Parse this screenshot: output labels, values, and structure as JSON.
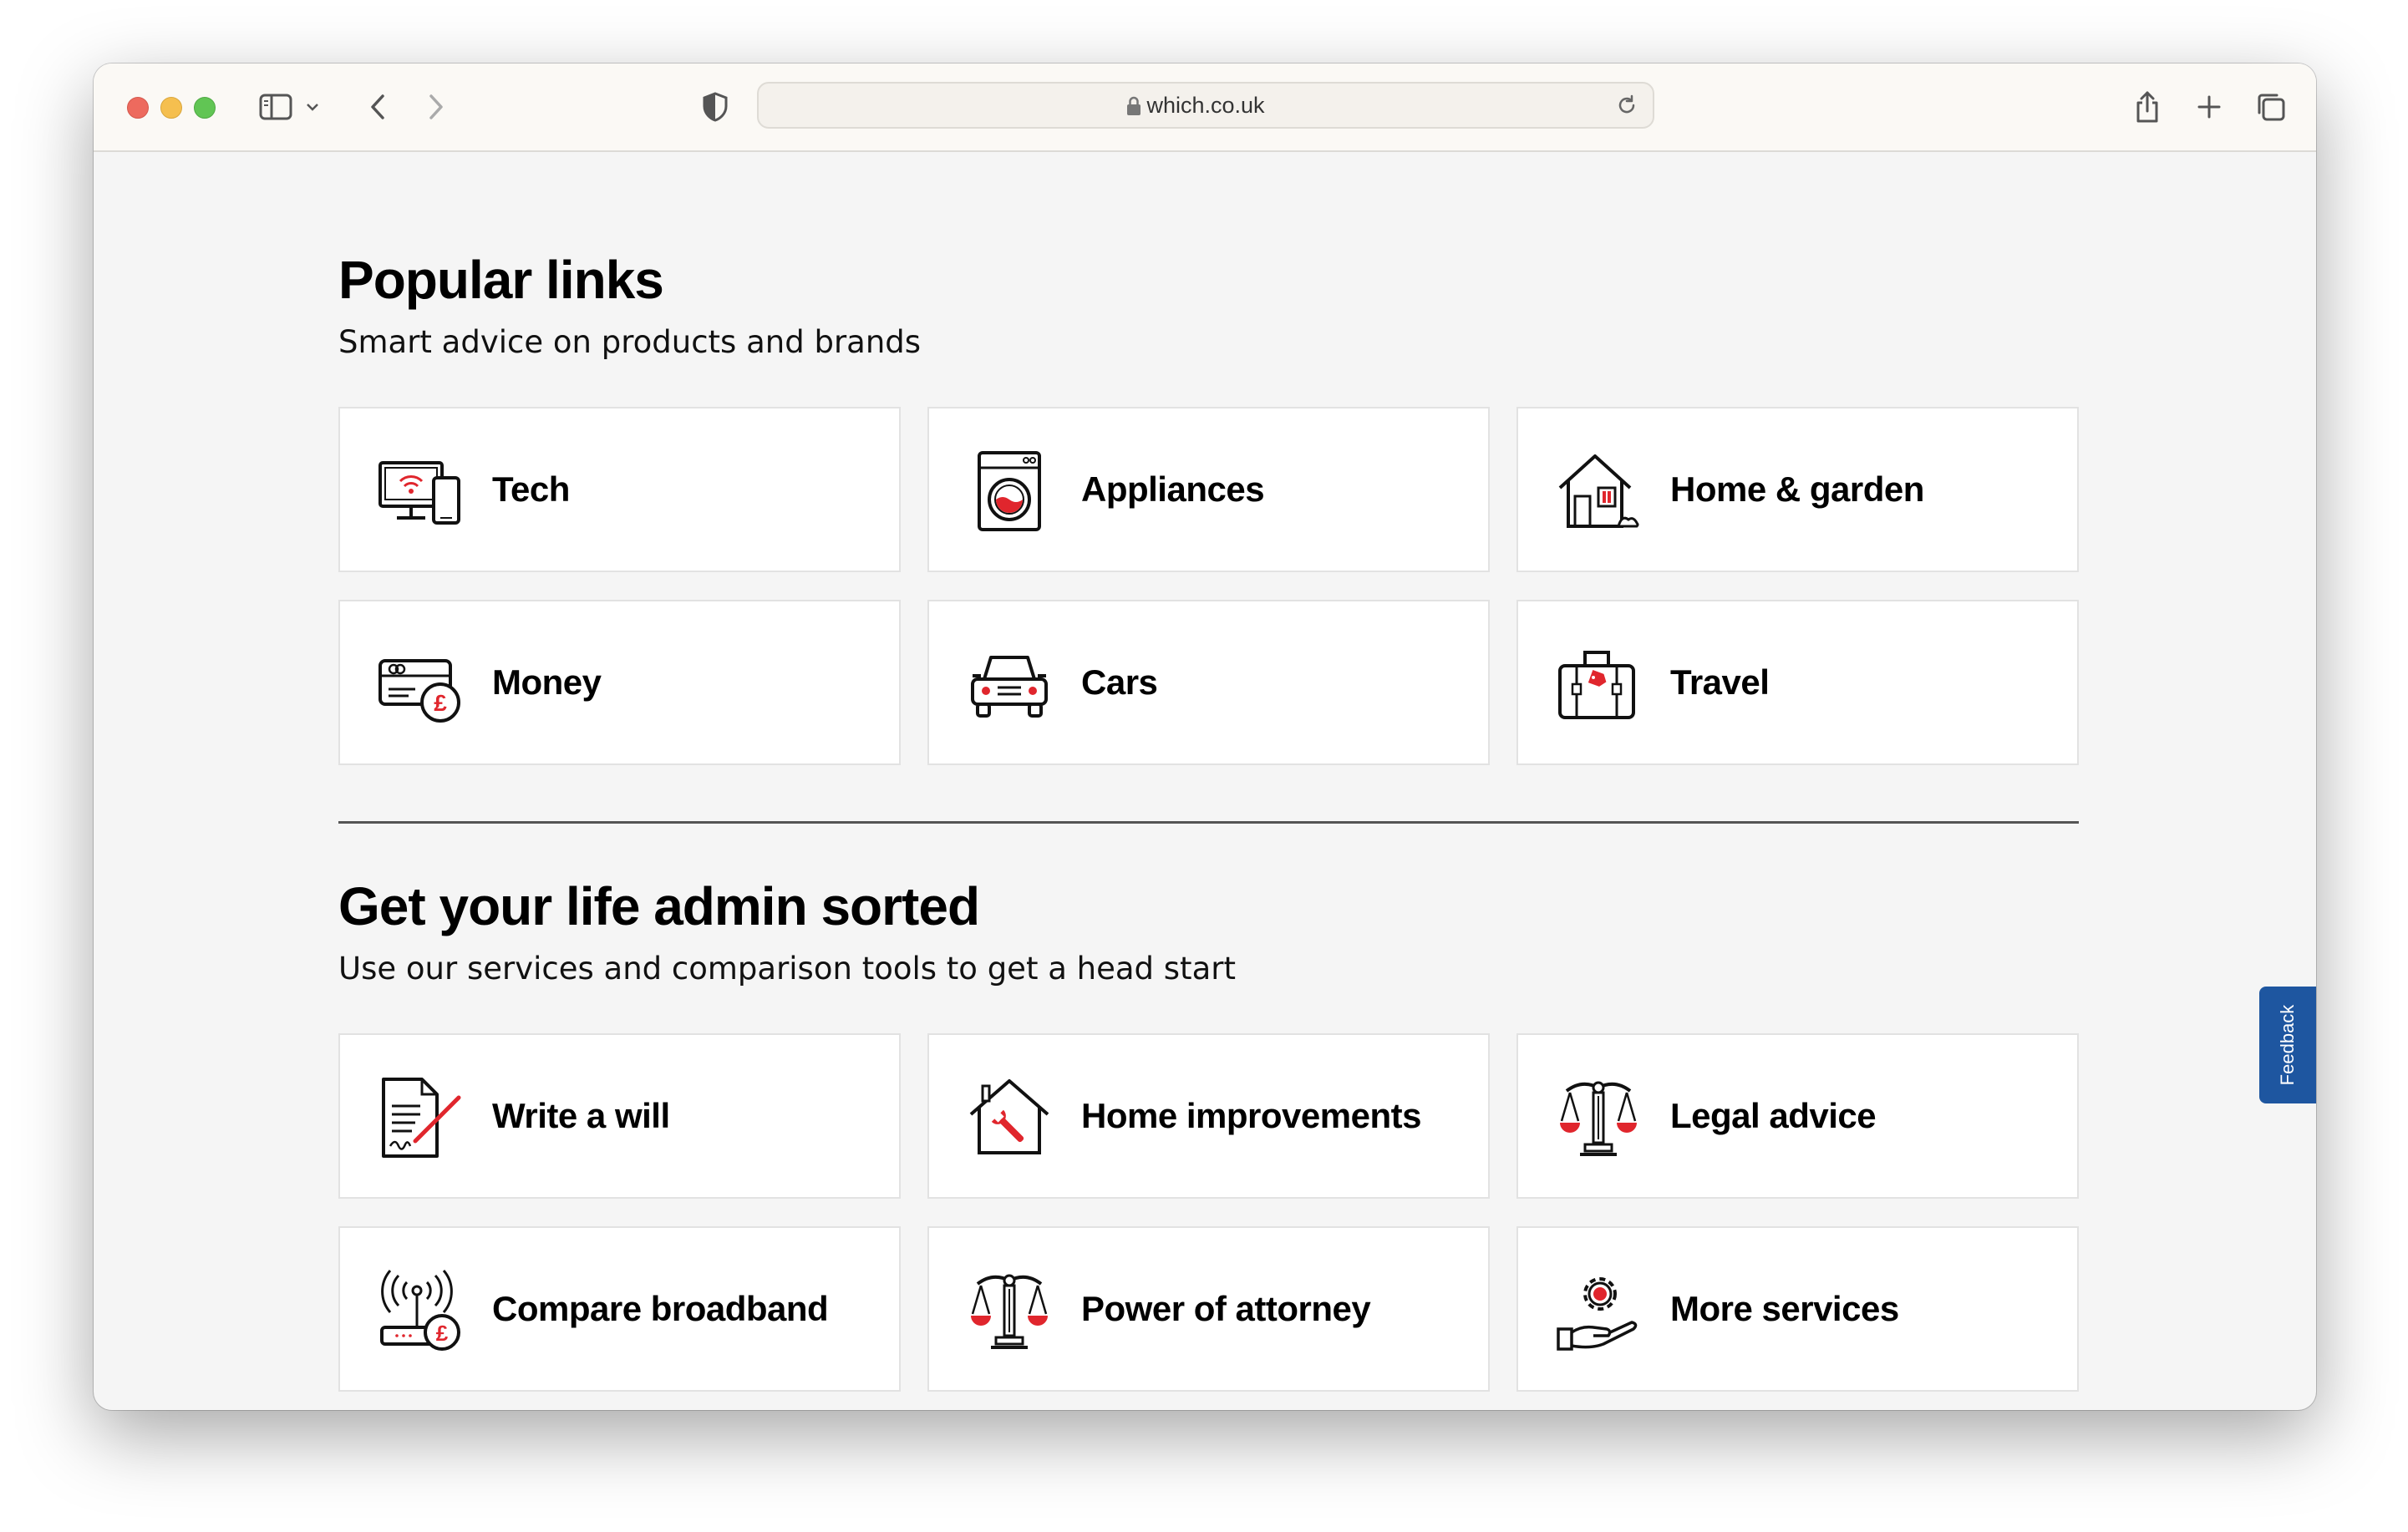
{
  "browser": {
    "url": "which.co.uk"
  },
  "popular": {
    "title": "Popular links",
    "subtitle": "Smart advice on products and brands",
    "cards": [
      {
        "label": "Tech",
        "icon": "devices-icon"
      },
      {
        "label": "Appliances",
        "icon": "washing-machine-icon"
      },
      {
        "label": "Home & garden",
        "icon": "house-icon"
      },
      {
        "label": "Money",
        "icon": "credit-card-pound-icon"
      },
      {
        "label": "Cars",
        "icon": "car-icon"
      },
      {
        "label": "Travel",
        "icon": "suitcase-icon"
      }
    ]
  },
  "admin": {
    "title": "Get your life admin sorted",
    "subtitle": "Use our services and comparison tools to get a head start",
    "cards": [
      {
        "label": "Write a will",
        "icon": "document-pen-icon"
      },
      {
        "label": "Home improvements",
        "icon": "house-wrench-icon"
      },
      {
        "label": "Legal advice",
        "icon": "scales-icon"
      },
      {
        "label": "Compare broadband",
        "icon": "router-pound-icon"
      },
      {
        "label": "Power of attorney",
        "icon": "scales-icon"
      },
      {
        "label": "More services",
        "icon": "hand-gear-icon"
      }
    ]
  },
  "feedback": {
    "label": "Feedback"
  },
  "colors": {
    "accent_red": "#e0262d",
    "feedback_blue": "#1e56a0",
    "page_bg": "#f5f5f5"
  }
}
